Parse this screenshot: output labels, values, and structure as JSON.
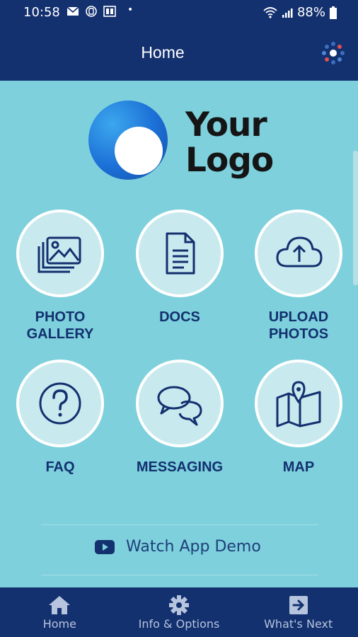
{
  "status_bar": {
    "time": "10:58",
    "battery": "88%",
    "icons": [
      "mail-icon",
      "sync-icon",
      "app-icon",
      "dot-icon",
      "wifi-icon",
      "signal-icon",
      "battery-icon"
    ]
  },
  "app_bar": {
    "title": "Home",
    "menu_icon": "dots-menu-icon"
  },
  "logo": {
    "line1": "Your",
    "line2": "Logo"
  },
  "tiles": [
    {
      "label_line1": "PHOTO",
      "label_line2": "GALLERY",
      "icon": "photo-gallery-icon"
    },
    {
      "label_line1": "DOCS",
      "label_line2": "",
      "icon": "document-icon"
    },
    {
      "label_line1": "UPLOAD",
      "label_line2": "PHOTOS",
      "icon": "cloud-upload-icon"
    },
    {
      "label_line1": "FAQ",
      "label_line2": "",
      "icon": "question-icon"
    },
    {
      "label_line1": "MESSAGING",
      "label_line2": "",
      "icon": "chat-bubbles-icon"
    },
    {
      "label_line1": "MAP",
      "label_line2": "",
      "icon": "map-icon"
    }
  ],
  "demo": {
    "label": "Watch App Demo",
    "icon": "youtube-icon"
  },
  "bottom_nav": [
    {
      "label": "Home",
      "icon": "home-icon"
    },
    {
      "label": "Info & Options",
      "icon": "gear-icon"
    },
    {
      "label": "What's Next",
      "icon": "arrow-right-box-icon"
    }
  ],
  "colors": {
    "primary_dark": "#13306f",
    "background": "#7dd0dc",
    "tile_fill": "#c8e9ee",
    "tile_text": "#13306f"
  }
}
